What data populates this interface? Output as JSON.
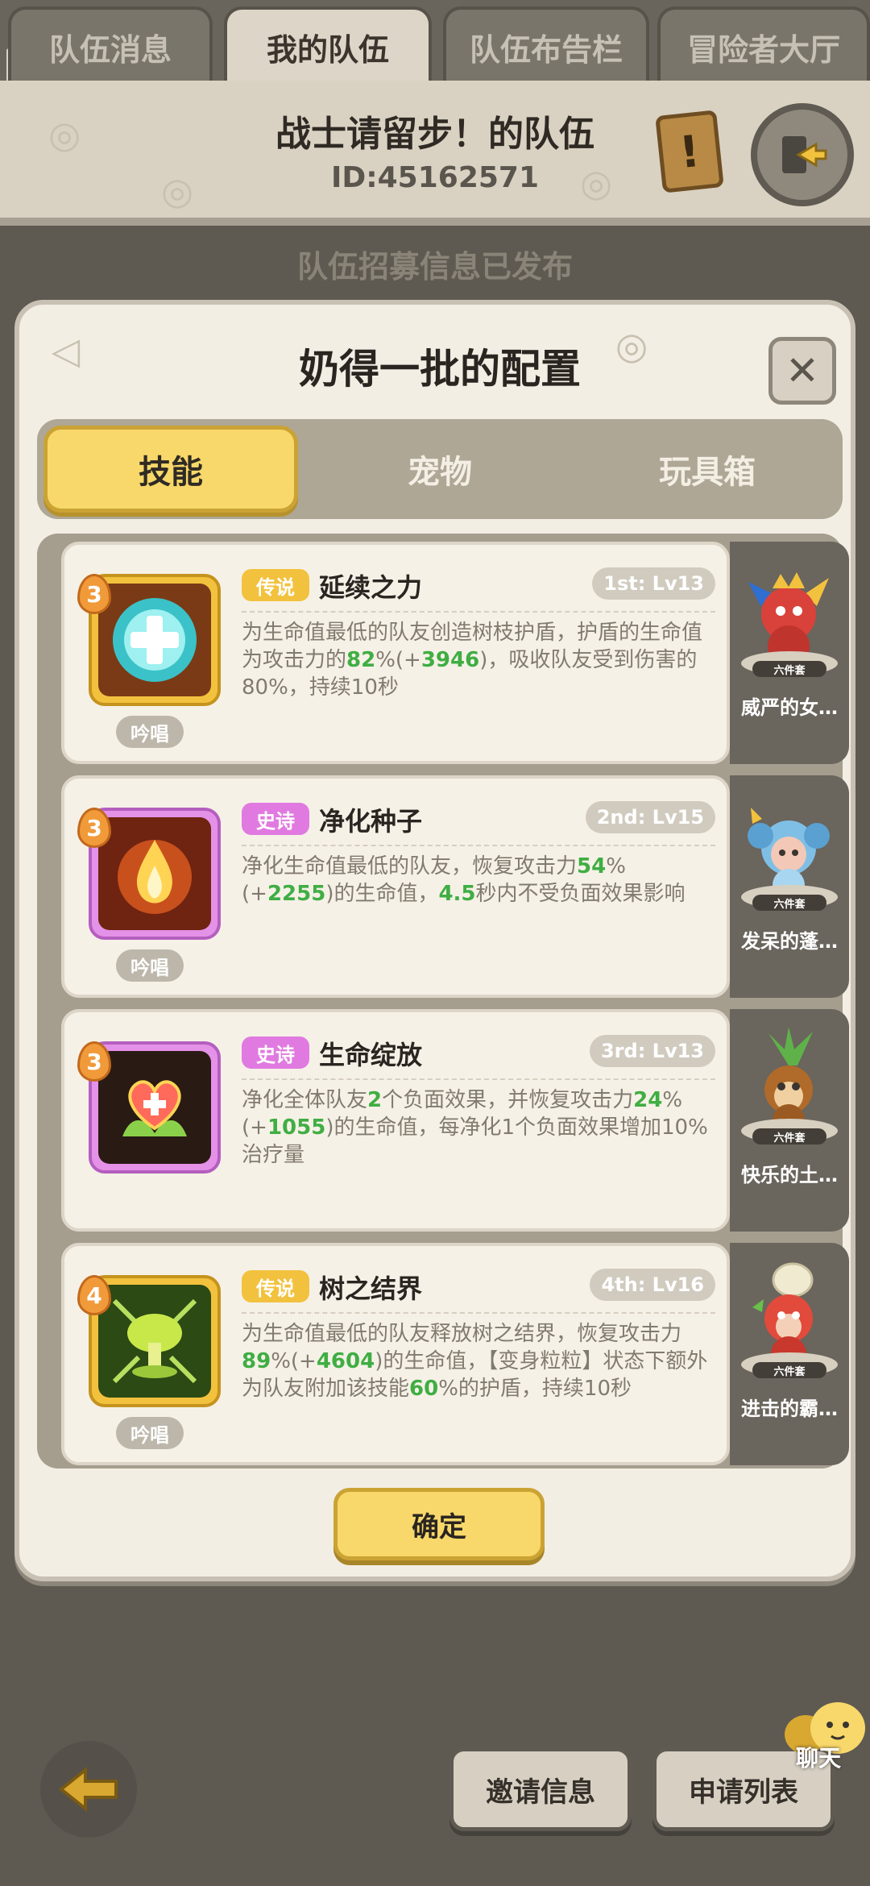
{
  "top_tabs": [
    {
      "label": "队伍消息"
    },
    {
      "label": "我的队伍"
    },
    {
      "label": "队伍布告栏"
    },
    {
      "label": "冒险者大厅"
    }
  ],
  "team": {
    "name": "战士请留步！的队伍",
    "id": "ID:45162571"
  },
  "recruit_message": "队伍招募信息已发布",
  "modal": {
    "title": "奶得一批的配置",
    "tabs": [
      {
        "label": "技能"
      },
      {
        "label": "宠物"
      },
      {
        "label": "玩具箱"
      }
    ],
    "skills": [
      {
        "level": "3",
        "rarity": "传说",
        "name": "延续之力",
        "slot": "1st: Lv13",
        "chant": "吟唱",
        "desc_a": "为生命值最低的队友创造树枝护盾，护盾的生命值为攻击力的",
        "v1": "82",
        "desc_b": "%(+",
        "v2": "3946",
        "desc_c": ")，吸收队友受到伤害的80%，持续10秒"
      },
      {
        "level": "3",
        "rarity": "史诗",
        "name": "净化种子",
        "slot": "2nd: Lv15",
        "chant": "吟唱",
        "desc_a": "净化生命值最低的队友，恢复攻击力",
        "v1": "54",
        "desc_b": "%(+",
        "v2": "2255",
        "desc_c": ")的生命值，",
        "v3": "4.5",
        "desc_d": "秒内不受负面效果影响"
      },
      {
        "level": "3",
        "rarity": "史诗",
        "name": "生命绽放",
        "slot": "3rd: Lv13",
        "desc_a": "净化全体队友",
        "v1": "2",
        "desc_b": "个负面效果，并恢复攻击力",
        "v2": "24",
        "desc_c": "%(+",
        "v3": "1055",
        "desc_d": ")的生命值，每净化1个负面效果增加10%治疗量"
      },
      {
        "level": "4",
        "rarity": "传说",
        "name": "树之结界",
        "slot": "4th: Lv16",
        "chant": "吟唱",
        "desc_a": "为生命值最低的队友释放树之结界，恢复攻击力",
        "v1": "89",
        "desc_b": "%(+",
        "v2": "4604",
        "desc_c": ")的生命值，【变身粒粒】状态下额外为队友附加该技能",
        "v3": "60",
        "desc_d": "%的护盾，持续10秒"
      }
    ],
    "pets": [
      {
        "name": "威严的女…",
        "set": "六件套"
      },
      {
        "name": "发呆的蓬…",
        "set": "六件套"
      },
      {
        "name": "快乐的土…",
        "set": "六件套"
      },
      {
        "name": "进击的霸…",
        "set": "六件套"
      }
    ],
    "confirm": "确定"
  },
  "bottom": {
    "invite": "邀请信息",
    "apply": "申请列表",
    "chat": "聊天"
  },
  "colors": {
    "legendary": "#f2c23e",
    "epic": "#e07ae0",
    "highlight": "#3fae43",
    "accent_yellow": "#f8d86a"
  }
}
